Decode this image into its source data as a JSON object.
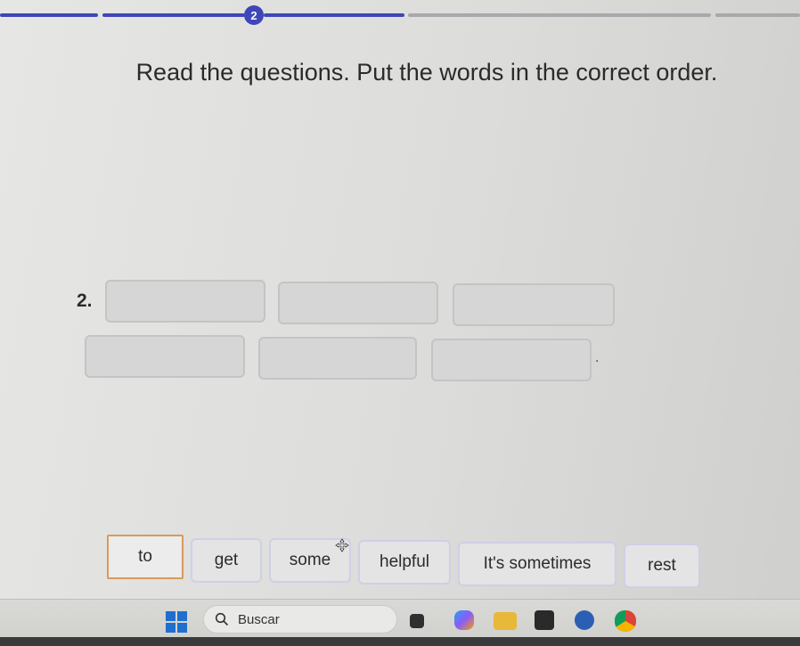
{
  "progress": {
    "current_step": "2"
  },
  "instruction": "Read the questions. Put the words in the correct order.",
  "question": {
    "number": "2.",
    "period": "."
  },
  "word_bank": [
    "to",
    "get",
    "some",
    "helpful",
    "It's sometimes",
    "rest"
  ],
  "taskbar": {
    "search_placeholder": "Buscar"
  },
  "colors": {
    "accent": "#3f46b8",
    "selected_chip_border": "#d89b5a"
  }
}
